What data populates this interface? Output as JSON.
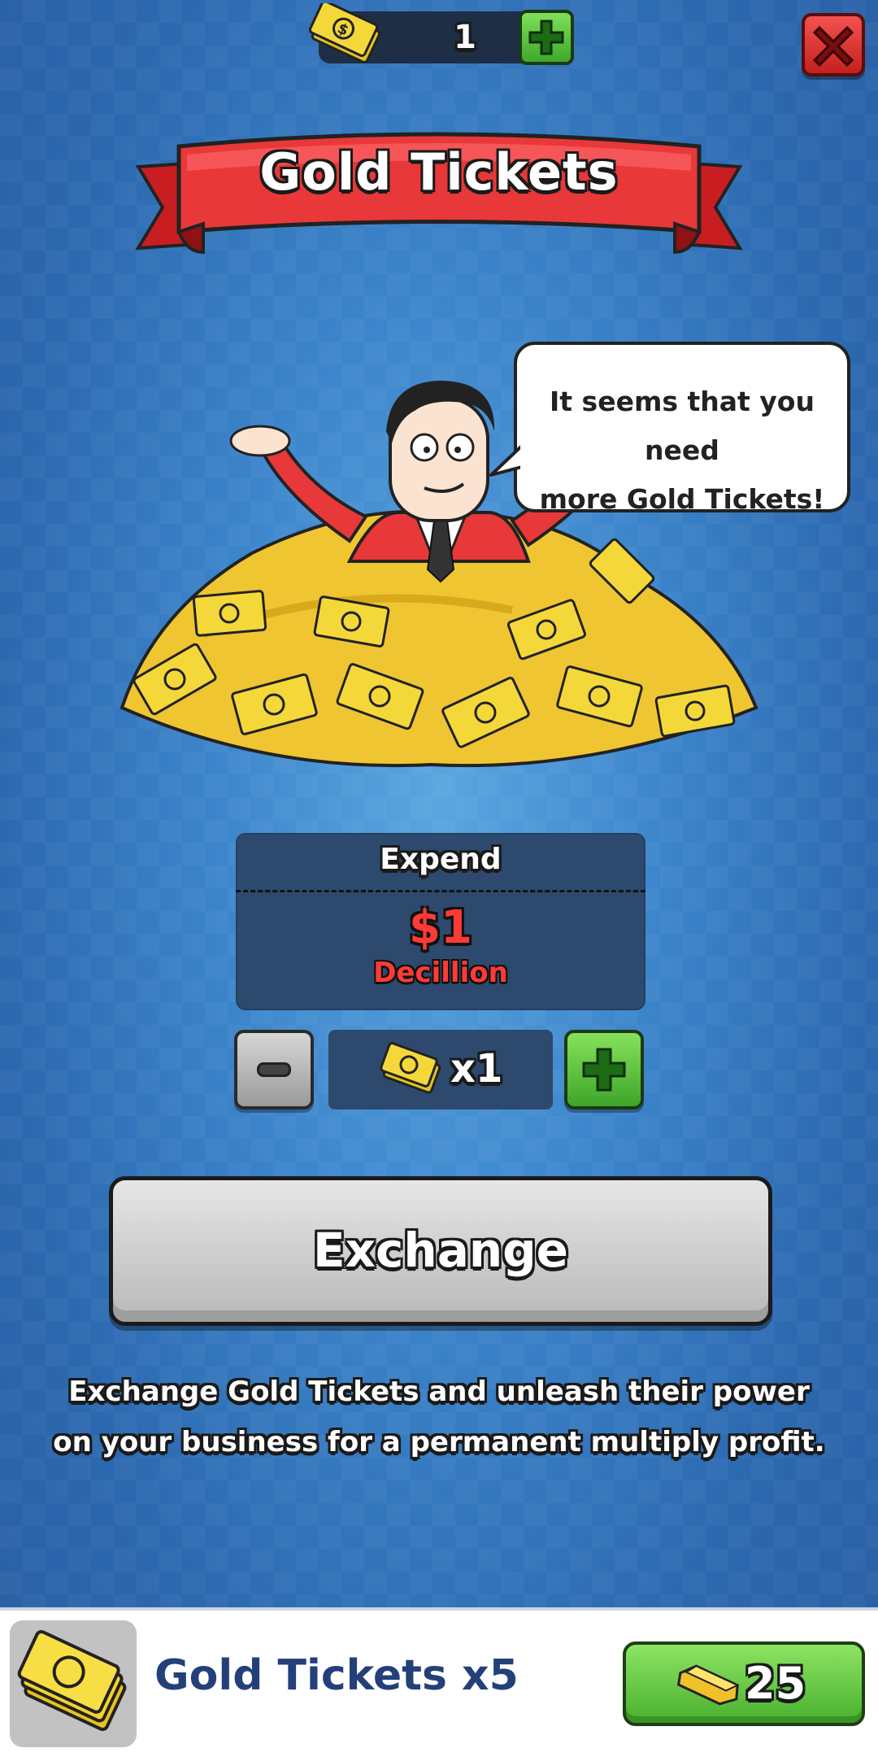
{
  "header": {
    "ticket_count": "1",
    "icons": {
      "currency": "gold-ticket-icon",
      "add": "plus-icon",
      "close": "close-icon"
    }
  },
  "banner": {
    "title": "Gold Tickets"
  },
  "speech": {
    "line1": "It seems that you need",
    "line2": "more Gold Tickets!"
  },
  "expend": {
    "label": "Expend",
    "amount": "$1",
    "unit": "Decillion"
  },
  "stepper": {
    "quantity": "x1"
  },
  "exchange": {
    "label": "Exchange"
  },
  "description": {
    "line1": "Exchange Gold Tickets and unleash their power",
    "line2": "on your business for a permanent multiply profit."
  },
  "offer": {
    "title": "Gold Tickets x5",
    "price": "25",
    "price_icon": "gold-bar-icon"
  },
  "colors": {
    "accent_green": "#49b02f",
    "banner_red": "#e8383a",
    "cost_red": "#ff3b35",
    "offer_text": "#24407a"
  }
}
